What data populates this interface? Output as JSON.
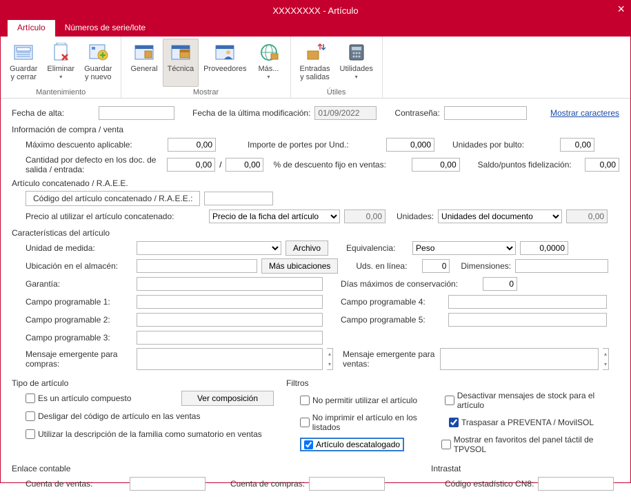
{
  "window": {
    "title": "XXXXXXXX - Artículo"
  },
  "tabs": {
    "article": "Artículo",
    "serials": "Números de serie/lote"
  },
  "ribbon": {
    "maintenance": {
      "label": "Mantenimiento",
      "save_close": "Guardar\ny cerrar",
      "delete": "Eliminar",
      "save_new": "Guardar\ny nuevo"
    },
    "show": {
      "label": "Mostrar",
      "general": "General",
      "technique": "Técnica",
      "suppliers": "Proveedores",
      "more": "Más..."
    },
    "utils": {
      "label": "Útiles",
      "inout": "Entradas\ny salidas",
      "utilities": "Utilidades"
    }
  },
  "form": {
    "fecha_alta": "Fecha de alta:",
    "fecha_mod": "Fecha de la última modificación:",
    "fecha_mod_val": "01/09/2022",
    "contrasena": "Contraseña:",
    "mostrar_car": "Mostrar caracteres",
    "info_compra": "Información de compra / venta",
    "max_desc": "Máximo descuento aplicable:",
    "max_desc_val": "0,00",
    "cant_def": "Cantidad por defecto en los doc. de salida / entrada:",
    "cant_def_v1": "0,00",
    "cant_def_v2": "0,00",
    "imp_portes": "Importe de portes por Und.:",
    "imp_portes_val": "0,000",
    "pct_desc": "% de descuento fijo en ventas:",
    "pct_desc_val": "0,00",
    "uds_bulto": "Unidades por bulto:",
    "uds_bulto_val": "0,00",
    "saldo": "Saldo/puntos fidelización:",
    "saldo_val": "0,00",
    "concat_title": "Artículo concatenado / R.A.E.E.",
    "concat_code": "Código del artículo concatenado / R.A.E.E.:",
    "precio_concat": "Precio al utilizar el artículo concatenado:",
    "precio_sel": "Precio de la ficha del artículo",
    "precio_val": "0,00",
    "unidades": "Unidades:",
    "unidades_sel": "Unidades del documento",
    "unidades_val": "0,00",
    "caract": "Características del artículo",
    "um": "Unidad de medida:",
    "archivo": "Archivo",
    "equiv": "Equivalencia:",
    "equiv_sel": "Peso",
    "equiv_val": "0,0000",
    "ubic": "Ubicación en el almacén:",
    "mas_ubic": "Más ubicaciones",
    "uds_linea": "Uds. en línea:",
    "uds_linea_val": "0",
    "dim": "Dimensiones:",
    "garantia": "Garantía:",
    "dias_cons": "Días máximos de conservación:",
    "dias_cons_val": "0",
    "cp1": "Campo programable 1:",
    "cp2": "Campo programable 2:",
    "cp3": "Campo programable 3:",
    "cp4": "Campo programable 4:",
    "cp5": "Campo programable 5:",
    "msg_compra": "Mensaje emergente para compras:",
    "msg_venta": "Mensaje emergente para ventas:",
    "tipo_title": "Tipo de artículo",
    "compuesto": "Es un artículo compuesto",
    "ver_comp": "Ver composición",
    "desligar": "Desligar del código de artículo en las ventas",
    "util_desc": "Utilizar la descripción de la familia como sumatorio en ventas",
    "filtros": "Filtros",
    "no_permitir": "No permitir utilizar el artículo",
    "no_imprimir": "No imprimir el artículo en los listados",
    "descatalogado": "Artículo descatalogado",
    "desact_stock": "Desactivar mensajes de stock para el artículo",
    "traspasar": "Traspasar a PREVENTA / MovilSOL",
    "mostrar_fav": "Mostrar en favoritos del panel táctil de TPVSOL",
    "enlace": "Enlace contable",
    "cta_ventas": "Cuenta de ventas:",
    "cta_compras": "Cuenta de compras:",
    "intrastat": "Intrastat",
    "cn8": "Código estadístico CN8:"
  }
}
